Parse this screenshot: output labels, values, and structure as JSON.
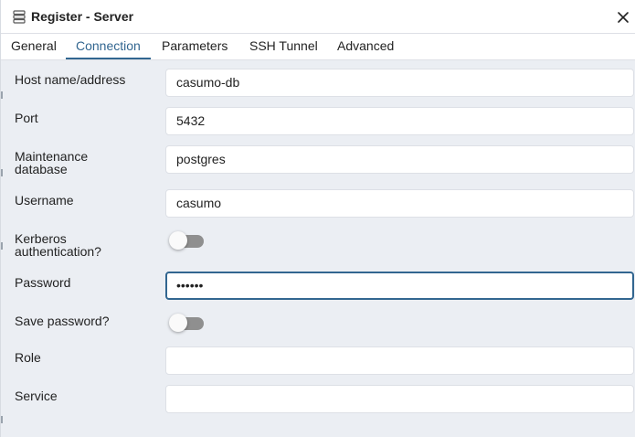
{
  "dialog": {
    "title": "Register - Server",
    "title_icon": "server-icon",
    "close_icon": "close-icon"
  },
  "tabs": [
    {
      "label": "General",
      "active": false
    },
    {
      "label": "Connection",
      "active": true
    },
    {
      "label": "Parameters",
      "active": false
    },
    {
      "label": "SSH Tunnel",
      "active": false
    },
    {
      "label": "Advanced",
      "active": false
    }
  ],
  "form": {
    "host": {
      "label": "Host name/address",
      "value": "casumo-db"
    },
    "port": {
      "label": "Port",
      "value": "5432"
    },
    "maintenance_db": {
      "label_line1": "Maintenance",
      "label_line2": "database",
      "value": "postgres"
    },
    "username": {
      "label": "Username",
      "value": "casumo"
    },
    "kerberos": {
      "label_line1": "Kerberos",
      "label_line2": "authentication?",
      "enabled": false
    },
    "password": {
      "label": "Password",
      "value": "••••••"
    },
    "save_password": {
      "label": "Save password?",
      "enabled": false
    },
    "role": {
      "label": "Role",
      "value": ""
    },
    "service": {
      "label": "Service",
      "value": ""
    }
  },
  "colors": {
    "accent": "#326690",
    "panel_bg": "#ebeef3",
    "toggle_off_track": "#8f8f8f"
  }
}
